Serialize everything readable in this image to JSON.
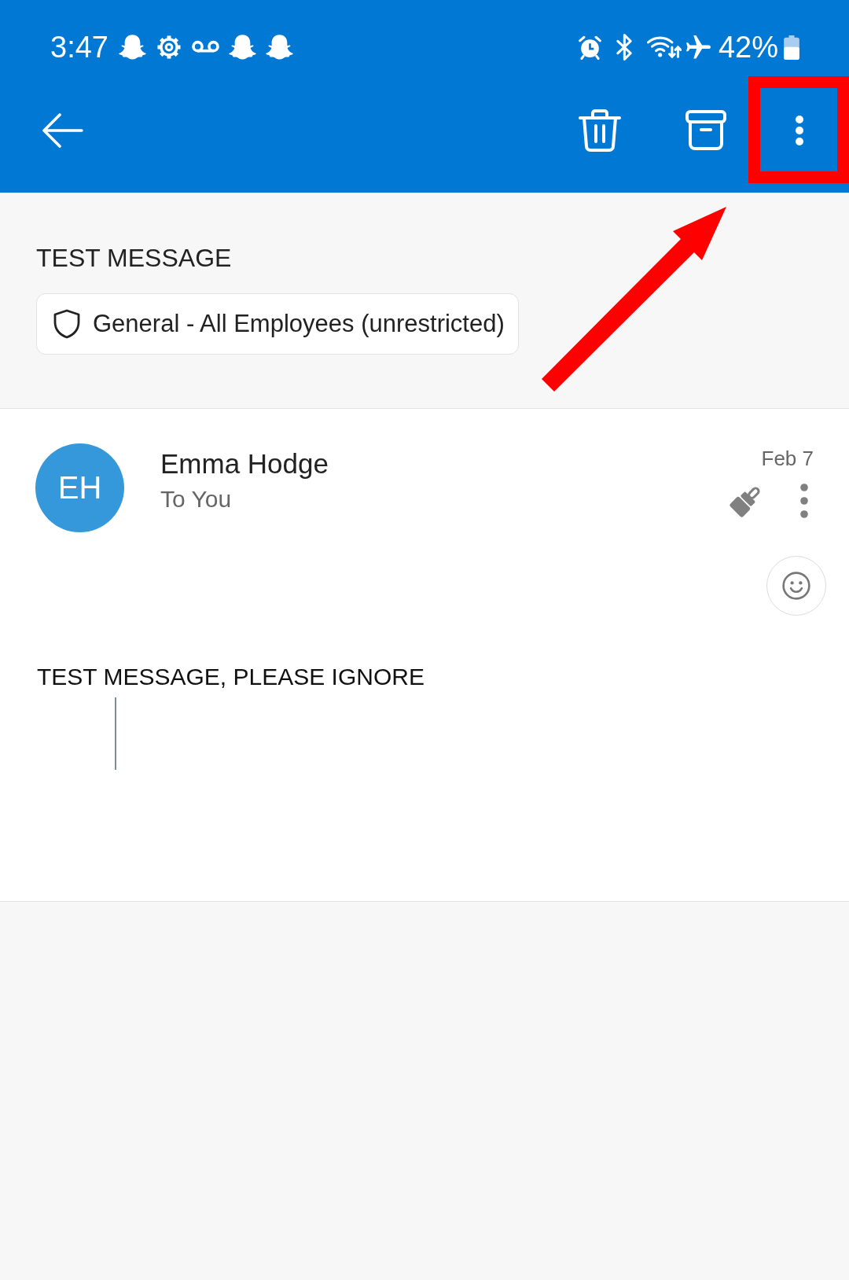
{
  "status_bar": {
    "time": "3:47",
    "battery": "42%"
  },
  "app_bar": {
    "more_button": {
      "highlighted": true
    }
  },
  "subject": "TEST MESSAGE",
  "sensitivity_label": "General - All Employees (unrestricted)",
  "messages": [
    {
      "initials": "EH",
      "sender": "Emma Hodge",
      "recipients": "To You",
      "date": "Feb 7",
      "body": "TEST MESSAGE, PLEASE IGNORE"
    }
  ]
}
